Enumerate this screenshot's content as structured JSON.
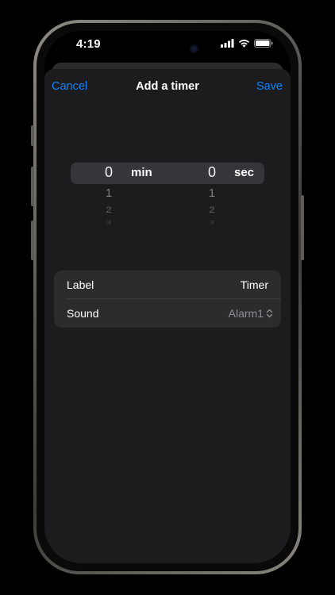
{
  "status_bar": {
    "time": "4:19"
  },
  "nav": {
    "cancel_label": "Cancel",
    "title": "Add a timer",
    "save_label": "Save"
  },
  "picker": {
    "minutes": {
      "selected": "0",
      "following": [
        "1",
        "2",
        "3"
      ],
      "unit": "min"
    },
    "seconds": {
      "selected": "0",
      "following": [
        "1",
        "2",
        "3"
      ],
      "unit": "sec"
    }
  },
  "settings": {
    "label_row": {
      "title": "Label",
      "value": "Timer"
    },
    "sound_row": {
      "title": "Sound",
      "value": "Alarm1"
    }
  },
  "icons": {
    "signal": "cellular-signal-icon",
    "wifi": "wifi-icon",
    "battery": "battery-icon",
    "sound_picker": "chevron-up-down-icon"
  },
  "colors": {
    "accent": "#0a84ff",
    "sheet_background": "#1c1c1e",
    "group_background": "#2c2c2e",
    "secondary_text": "#8e8e93"
  }
}
